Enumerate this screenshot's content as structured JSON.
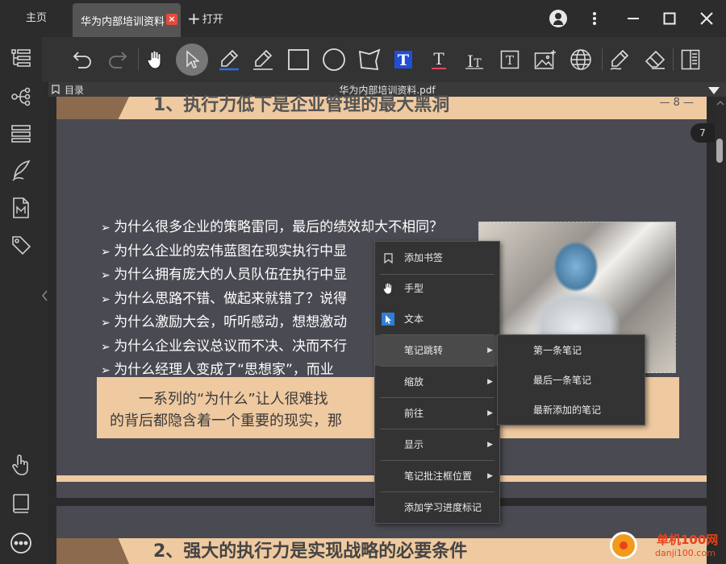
{
  "titlebar": {
    "home_tab": "主页",
    "doc_tab": "华为内部培训资料",
    "close_glyph": "×",
    "open_label": "打开",
    "open_glyph": "+"
  },
  "docbar": {
    "toc_label": "目录",
    "filename": "华为内部培训资料.pdf"
  },
  "page": {
    "heading": "1、执行力低下是企业管理的最大黑洞",
    "page_number": "— 8 —",
    "bullets": [
      "为什么很多企业的策略雷同，最后的绩效却大不相同？",
      "为什么企业的宏伟蓝图在现实执行中显",
      "为什么拥有庞大的人员队伍在执行中显",
      "为什么思路不错、做起来就错了？说得",
      "为什么激励大会，听听感动，想想激动",
      "为什么企业会议总议而不决、决而不行",
      "为什么经理人变成了“思想家”，而业"
    ],
    "summary_line1": "一系列的“为什么”让人很难找",
    "summary_line2": "的背后都隐含着一个重要的现实，那"
  },
  "page2": {
    "heading": "2、强大的执行力是实现战略的必要条件"
  },
  "page_indicator": "7",
  "context_menu": {
    "items": [
      {
        "label": "添加书签",
        "icon": "bookmark-icon"
      },
      {
        "label": "手型",
        "icon": "hand-icon"
      },
      {
        "label": "文本",
        "icon": "text-select-icon"
      },
      {
        "label": "笔记跳转",
        "submenu": true
      },
      {
        "label": "缩放",
        "submenu": true
      },
      {
        "label": "前往",
        "submenu": true
      },
      {
        "label": "显示",
        "submenu": true
      },
      {
        "label": "笔记批注框位置",
        "submenu": true
      },
      {
        "label": "添加学习进度标记"
      }
    ],
    "submenu_arrow": "▶"
  },
  "submenu": {
    "items": [
      "第一条笔记",
      "最后一条笔记",
      "最新添加的笔记"
    ]
  },
  "watermark": {
    "brand": "单机100网",
    "url": "danji100.com"
  },
  "colors": {
    "accent_beige": "#efc9a0",
    "accent_brown": "#8b6a4e",
    "page_bg": "#4a4a52",
    "close_red": "#e64a3b"
  }
}
